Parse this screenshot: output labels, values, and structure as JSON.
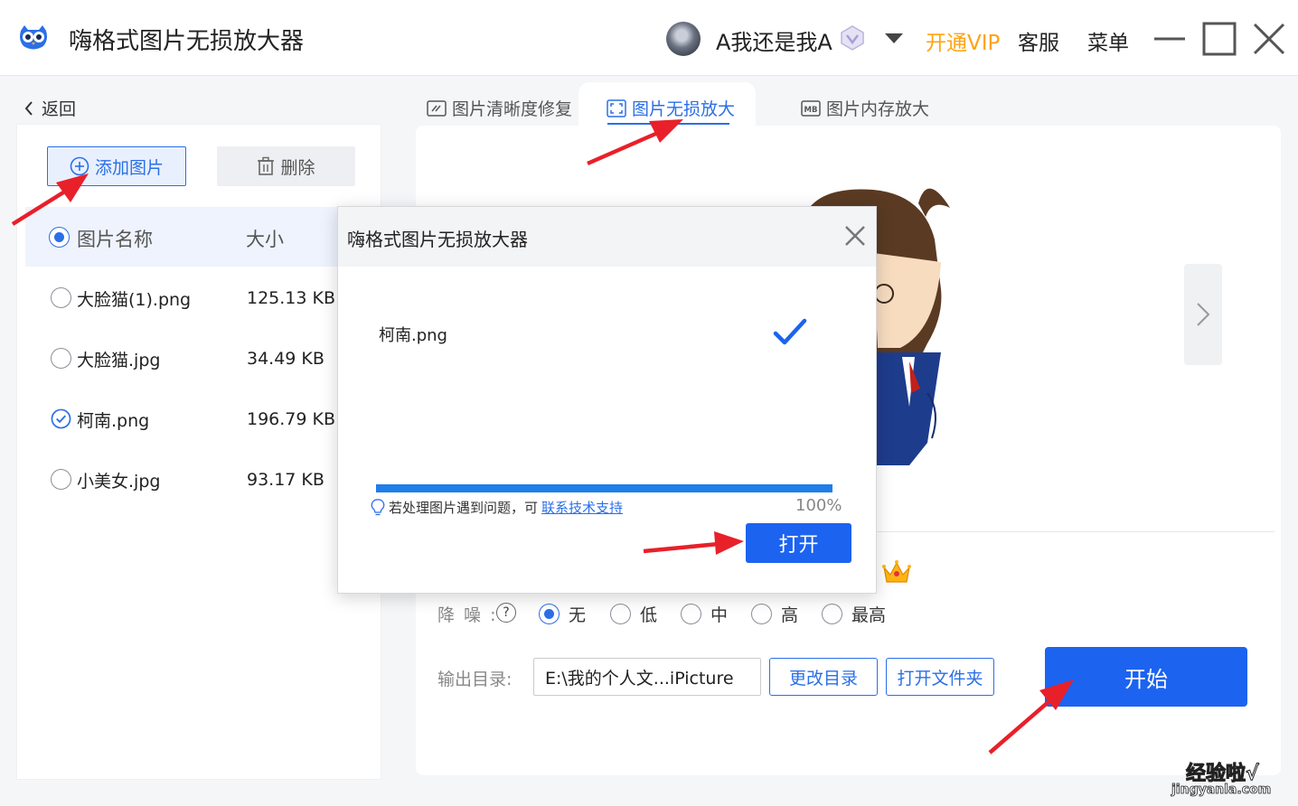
{
  "app": {
    "title": "嗨格式图片无损放大器",
    "username": "A我还是我A",
    "vip_label": "开通VIP",
    "service_label": "客服",
    "menu_label": "菜单"
  },
  "nav": {
    "back_label": "返回"
  },
  "toolbar": {
    "add_label": "添加图片",
    "delete_label": "删除"
  },
  "file_list": {
    "header_name": "图片名称",
    "header_size": "大小",
    "rows": [
      {
        "name": "大脸猫(1).png",
        "size": "125.13 KB",
        "checked": false
      },
      {
        "name": "大脸猫.jpg",
        "size": "34.49 KB",
        "checked": false
      },
      {
        "name": "柯南.png",
        "size": "196.79 KB",
        "checked": true
      },
      {
        "name": "小美女.jpg",
        "size": "93.17 KB",
        "checked": false
      }
    ]
  },
  "tabs": [
    {
      "label": "图片清晰度修复",
      "icon": "image-fix-icon",
      "active": false
    },
    {
      "label": "图片无损放大",
      "icon": "expand-icon",
      "active": true
    },
    {
      "label": "图片内存放大",
      "icon": "mb-icon",
      "active": false
    }
  ],
  "settings": {
    "noise_label": "降 噪 :",
    "noise_help": "?",
    "noise_options": [
      {
        "label": "无",
        "selected": true
      },
      {
        "label": "低",
        "selected": false
      },
      {
        "label": "中",
        "selected": false
      },
      {
        "label": "高",
        "selected": false
      },
      {
        "label": "最高",
        "selected": false
      }
    ],
    "output_label": "输出目录:",
    "output_path": "E:\\我的个人文...iPicture",
    "change_dir_label": "更改目录",
    "open_folder_label": "打开文件夹",
    "start_label": "开始"
  },
  "dialog": {
    "title": "嗨格式图片无损放大器",
    "file_name": "柯南.png",
    "progress": 1.0,
    "progress_text": "100%",
    "hint_text": "若处理图片遇到问题，可",
    "support_link": "联系技术支持",
    "open_label": "打开"
  },
  "watermark": {
    "top": "经验啦√",
    "bottom": "jingyanla.com"
  },
  "colors": {
    "accent": "#1c63f0",
    "vip": "#ffa312",
    "arrow": "#e8202a"
  }
}
